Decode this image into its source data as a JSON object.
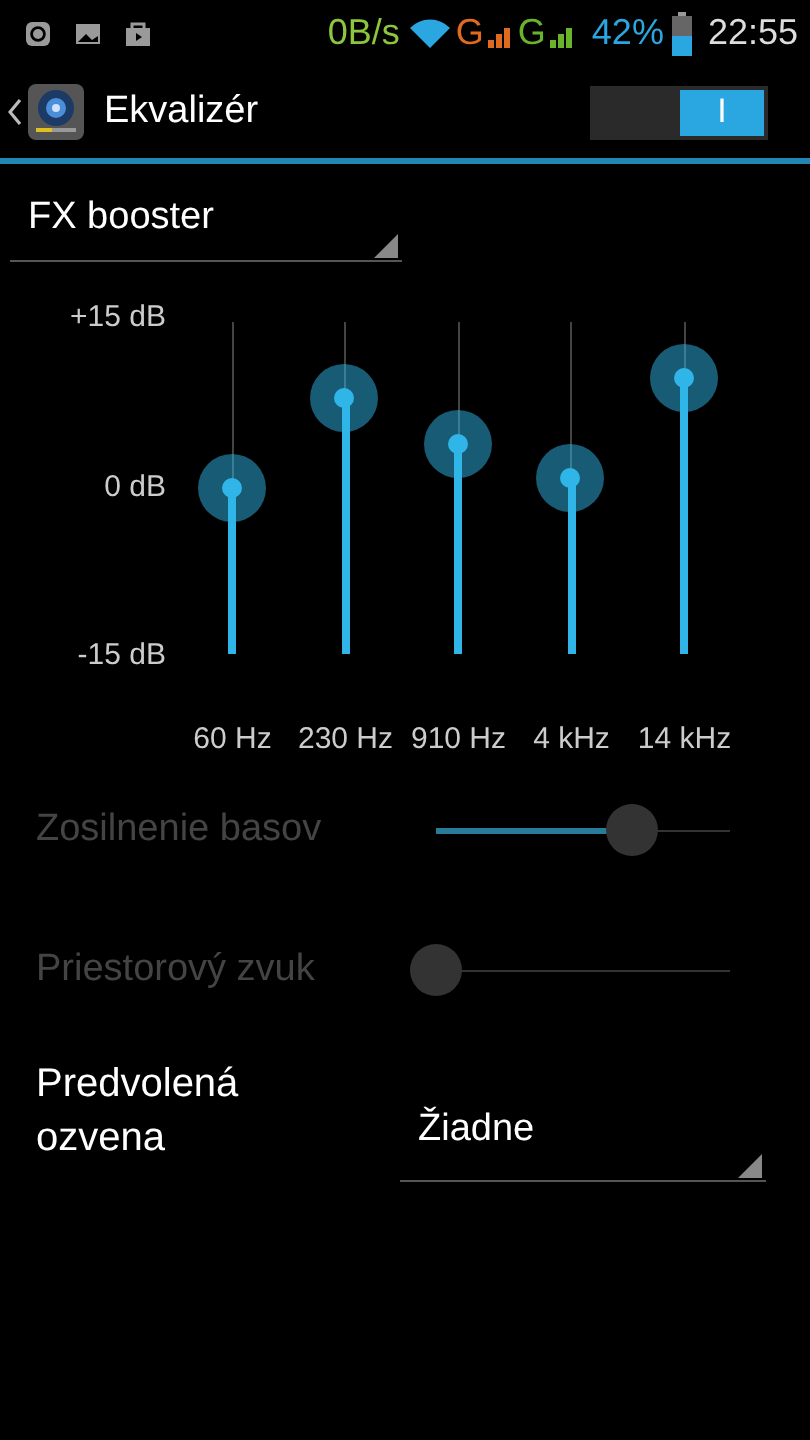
{
  "status_bar": {
    "speed": "0B/s",
    "network_1": "G",
    "network_2": "G",
    "battery": "42%",
    "time": "22:55"
  },
  "action_bar": {
    "title": "Ekvalizér",
    "switch": {
      "on": true,
      "on_label": "I"
    }
  },
  "preset": {
    "value": "FX booster"
  },
  "equalizer": {
    "scale": [
      "+15 dB",
      "0 dB",
      "-15 dB"
    ],
    "bands": [
      {
        "label": "60 Hz",
        "level": 0.5
      },
      {
        "label": "230 Hz",
        "level": 0.77
      },
      {
        "label": "910 Hz",
        "level": 0.63
      },
      {
        "label": "4 kHz",
        "level": 0.53
      },
      {
        "label": "14 kHz",
        "level": 0.83
      }
    ]
  },
  "effects": [
    {
      "label": "Zosilnenie basov",
      "disabled": true,
      "level": 0.67
    },
    {
      "label": "Priestorový zvuk",
      "disabled": true,
      "level": 0
    }
  ],
  "reverb": {
    "label": "Predvolená ozvena",
    "value": "Žiadne"
  }
}
